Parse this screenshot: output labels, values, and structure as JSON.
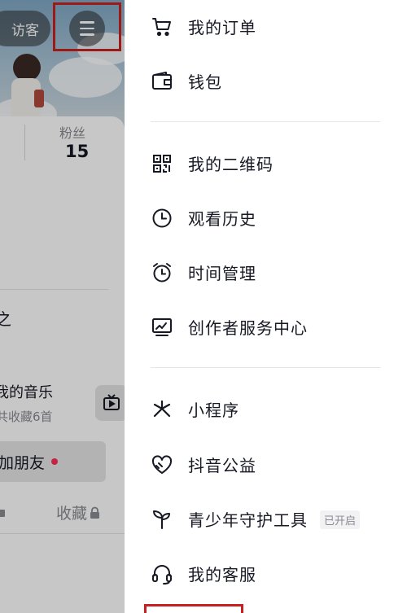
{
  "background": {
    "visitor_label": "访客",
    "fans_label": "粉丝",
    "fans_count": "15",
    "partial_heading": "之",
    "music_title": "我的音乐",
    "music_subtitle": "共收藏6首",
    "add_friend_label": "加朋友",
    "collect_label": "收藏"
  },
  "drawer": {
    "group1": [
      {
        "label": "我的订单",
        "icon": "shopping-cart-icon"
      },
      {
        "label": "钱包",
        "icon": "wallet-icon"
      }
    ],
    "group2": [
      {
        "label": "我的二维码",
        "icon": "qr-code-icon"
      },
      {
        "label": "观看历史",
        "icon": "clock-icon"
      },
      {
        "label": "时间管理",
        "icon": "alarm-clock-icon"
      },
      {
        "label": "创作者服务中心",
        "icon": "creator-monitor-icon"
      }
    ],
    "group3": [
      {
        "label": "小程序",
        "icon": "mini-program-icon"
      },
      {
        "label": "抖音公益",
        "icon": "charity-heart-icon"
      },
      {
        "label": "青少年守护工具",
        "icon": "sprout-icon",
        "badge": "已开启"
      },
      {
        "label": "我的客服",
        "icon": "headset-icon"
      }
    ]
  },
  "colors": {
    "highlight_box": "#c8201e",
    "notification_dot": "#fe2c55",
    "text_primary": "#161823",
    "text_secondary": "#8a8b91"
  }
}
